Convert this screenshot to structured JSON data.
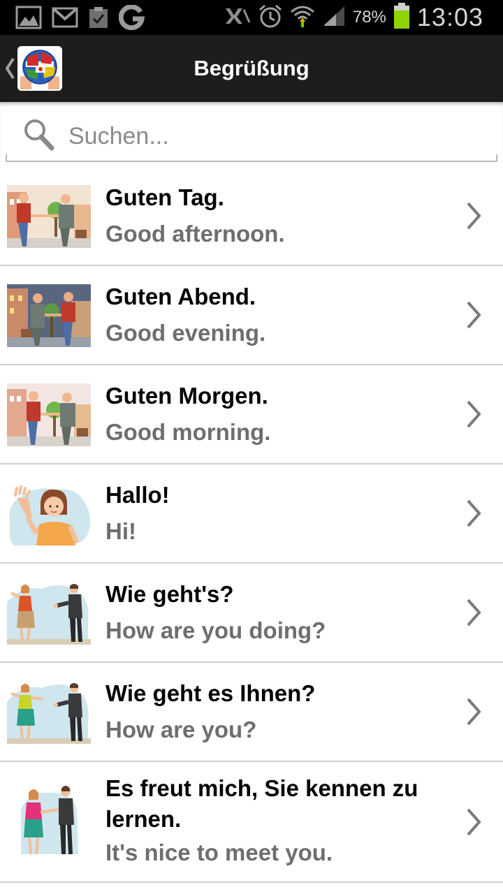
{
  "status_bar": {
    "battery_percent": "78%",
    "time": "13:03",
    "icons_left": [
      "gallery-icon",
      "gmail-icon",
      "clipboard-icon",
      "google-icon"
    ],
    "icons_right": [
      "no-signal-icon",
      "alarm-icon",
      "wifi-icon",
      "cell-signal-icon",
      "battery-icon"
    ],
    "battery_color": "#8fd400"
  },
  "title_bar": {
    "title": "Begrüßung",
    "background": "#1d1d1d"
  },
  "search": {
    "placeholder": "Suchen...",
    "value": ""
  },
  "phrases": [
    {
      "german": "Guten Tag.",
      "english": "Good afternoon.",
      "image": "handshake-day-picture"
    },
    {
      "german": "Guten Abend.",
      "english": "Good evening.",
      "image": "handshake-evening-picture"
    },
    {
      "german": "Guten Morgen.",
      "english": "Good morning.",
      "image": "handshake-morning-picture"
    },
    {
      "german": "Hallo!",
      "english": "Hi!",
      "image": "waving-woman-picture"
    },
    {
      "german": "Wie geht's?",
      "english": "How are you doing?",
      "image": "couple-greeting-picture"
    },
    {
      "german": "Wie geht es Ihnen?",
      "english": "How are you?",
      "image": "couple-greeting-formal-picture"
    },
    {
      "german": "Es freut mich, Sie kennen zu lernen.",
      "english": "It's nice to meet you.",
      "image": "couple-handshake-picture"
    }
  ],
  "colors": {
    "german_text": "#000000",
    "english_text": "#6e6e6e",
    "divider": "#cfcfcf"
  }
}
